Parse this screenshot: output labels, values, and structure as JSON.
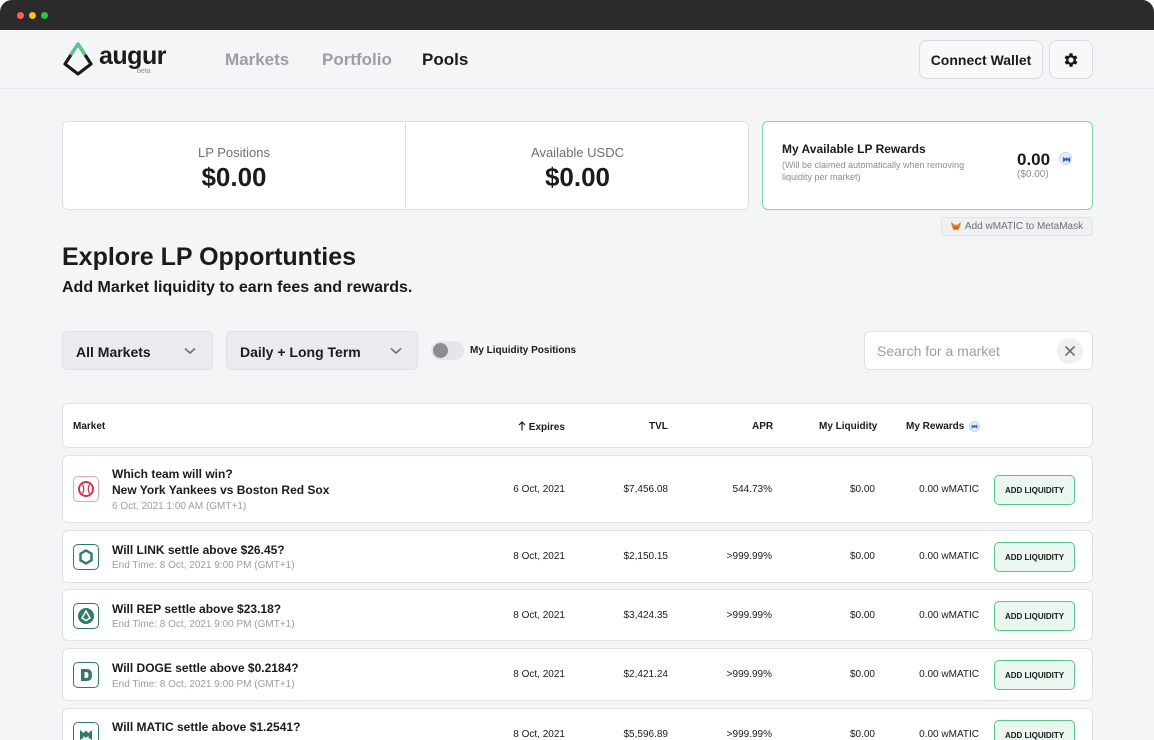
{
  "nav": {
    "logo_text": "augur",
    "logo_beta": "beta",
    "items": [
      {
        "label": "Markets",
        "active": false
      },
      {
        "label": "Portfolio",
        "active": false
      },
      {
        "label": "Pools",
        "active": true
      }
    ],
    "connect_label": "Connect Wallet"
  },
  "stats": {
    "lp_positions_label": "LP Positions",
    "lp_positions_value": "$0.00",
    "available_label": "Available USDC",
    "available_value": "$0.00"
  },
  "rewards": {
    "title": "My Available LP Rewards",
    "note": "(Will be claimed automatically when removing liquidity per market)",
    "amount": "0.00",
    "amount_usd": "($0.00)"
  },
  "metamask_label": "Add wMATIC to MetaMask",
  "heading": "Explore LP Opportunties",
  "subheading": "Add Market liquidity to earn fees and rewards.",
  "filters": {
    "market_type": "All Markets",
    "term": "Daily + Long Term",
    "toggle_label": "My Liquidity Positions",
    "toggle_on": false,
    "search_placeholder": "Search for a market"
  },
  "table": {
    "headers": {
      "market": "Market",
      "expires": "Expires",
      "tvl": "TVL",
      "apr": "APR",
      "my_liquidity": "My Liquidity",
      "my_rewards": "My Rewards"
    },
    "add_label": "ADD LIQUIDITY",
    "rows": [
      {
        "icon": "baseball-icon",
        "question": "Which team will win?",
        "question2": "New York Yankees vs Boston Red Sox",
        "sub": "6 Oct, 2021 1:00 AM (GMT+1)",
        "expires": "6 Oct, 2021",
        "tvl": "$7,456.08",
        "apr": "544.73%",
        "liquidity": "$0.00",
        "rewards": "0.00 wMATIC"
      },
      {
        "icon": "chainlink-icon",
        "question": "Will LINK settle above $26.45?",
        "question2": "",
        "sub": "End Time: 8 Oct, 2021 9:00 PM (GMT+1)",
        "expires": "8 Oct, 2021",
        "tvl": "$2,150.15",
        "apr": ">999.99%",
        "liquidity": "$0.00",
        "rewards": "0.00 wMATIC"
      },
      {
        "icon": "rep-icon",
        "question": "Will REP settle above $23.18?",
        "question2": "",
        "sub": "End Time: 8 Oct, 2021 9:00 PM (GMT+1)",
        "expires": "8 Oct, 2021",
        "tvl": "$3,424.35",
        "apr": ">999.99%",
        "liquidity": "$0.00",
        "rewards": "0.00 wMATIC"
      },
      {
        "icon": "doge-icon",
        "question": "Will DOGE settle above $0.2184?",
        "question2": "",
        "sub": "End Time: 8 Oct, 2021 9:00 PM (GMT+1)",
        "expires": "8 Oct, 2021",
        "tvl": "$2,421.24",
        "apr": ">999.99%",
        "liquidity": "$0.00",
        "rewards": "0.00 wMATIC"
      },
      {
        "icon": "matic-icon",
        "question": "Will MATIC settle above $1.2541?",
        "question2": "",
        "sub": "",
        "expires": "8 Oct, 2021",
        "tvl": "$5,596.89",
        "apr": ">999.99%",
        "liquidity": "$0.00",
        "rewards": "0.00 wMATIC"
      }
    ]
  },
  "colors": {
    "accent_green": "#57c78a",
    "baseball_red": "#d0364c",
    "crypto_teal": "#2f7a6d"
  }
}
